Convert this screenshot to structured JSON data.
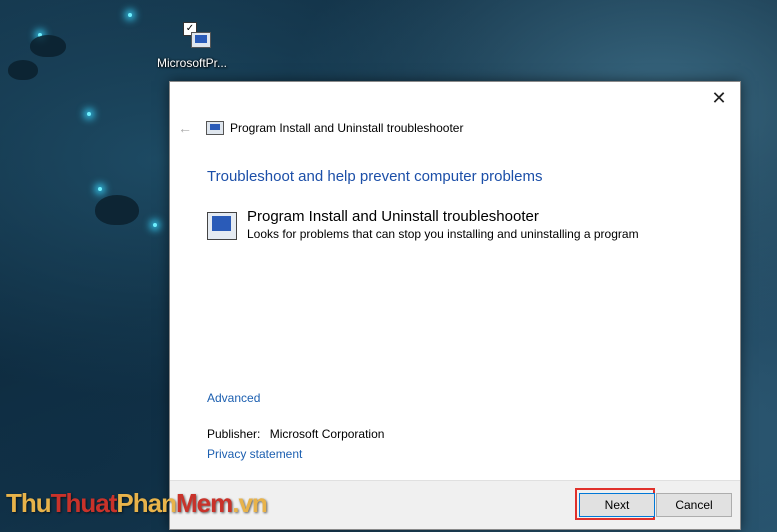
{
  "desktop": {
    "icon_label": "MicrosoftPr..."
  },
  "dialog": {
    "title": "Program Install and Uninstall troubleshooter",
    "heading": "Troubleshoot and help prevent computer problems",
    "item": {
      "title": "Program Install and Uninstall troubleshooter",
      "description": "Looks for problems that can stop you installing and uninstalling a program"
    },
    "advanced_link": "Advanced",
    "publisher_label": "Publisher:",
    "publisher_value": "Microsoft Corporation",
    "privacy_link": "Privacy statement",
    "next_button": "Next",
    "cancel_button": "Cancel",
    "close_glyph": "✕",
    "back_glyph": "←"
  },
  "watermark": {
    "part1": "Thu",
    "part2": "Thuat",
    "part3": "Phan",
    "part4": "Mem",
    "part5": ".vn"
  },
  "colors": {
    "heading": "#1c4fa8",
    "link": "#1c5fb0",
    "highlight": "#e0312b"
  }
}
